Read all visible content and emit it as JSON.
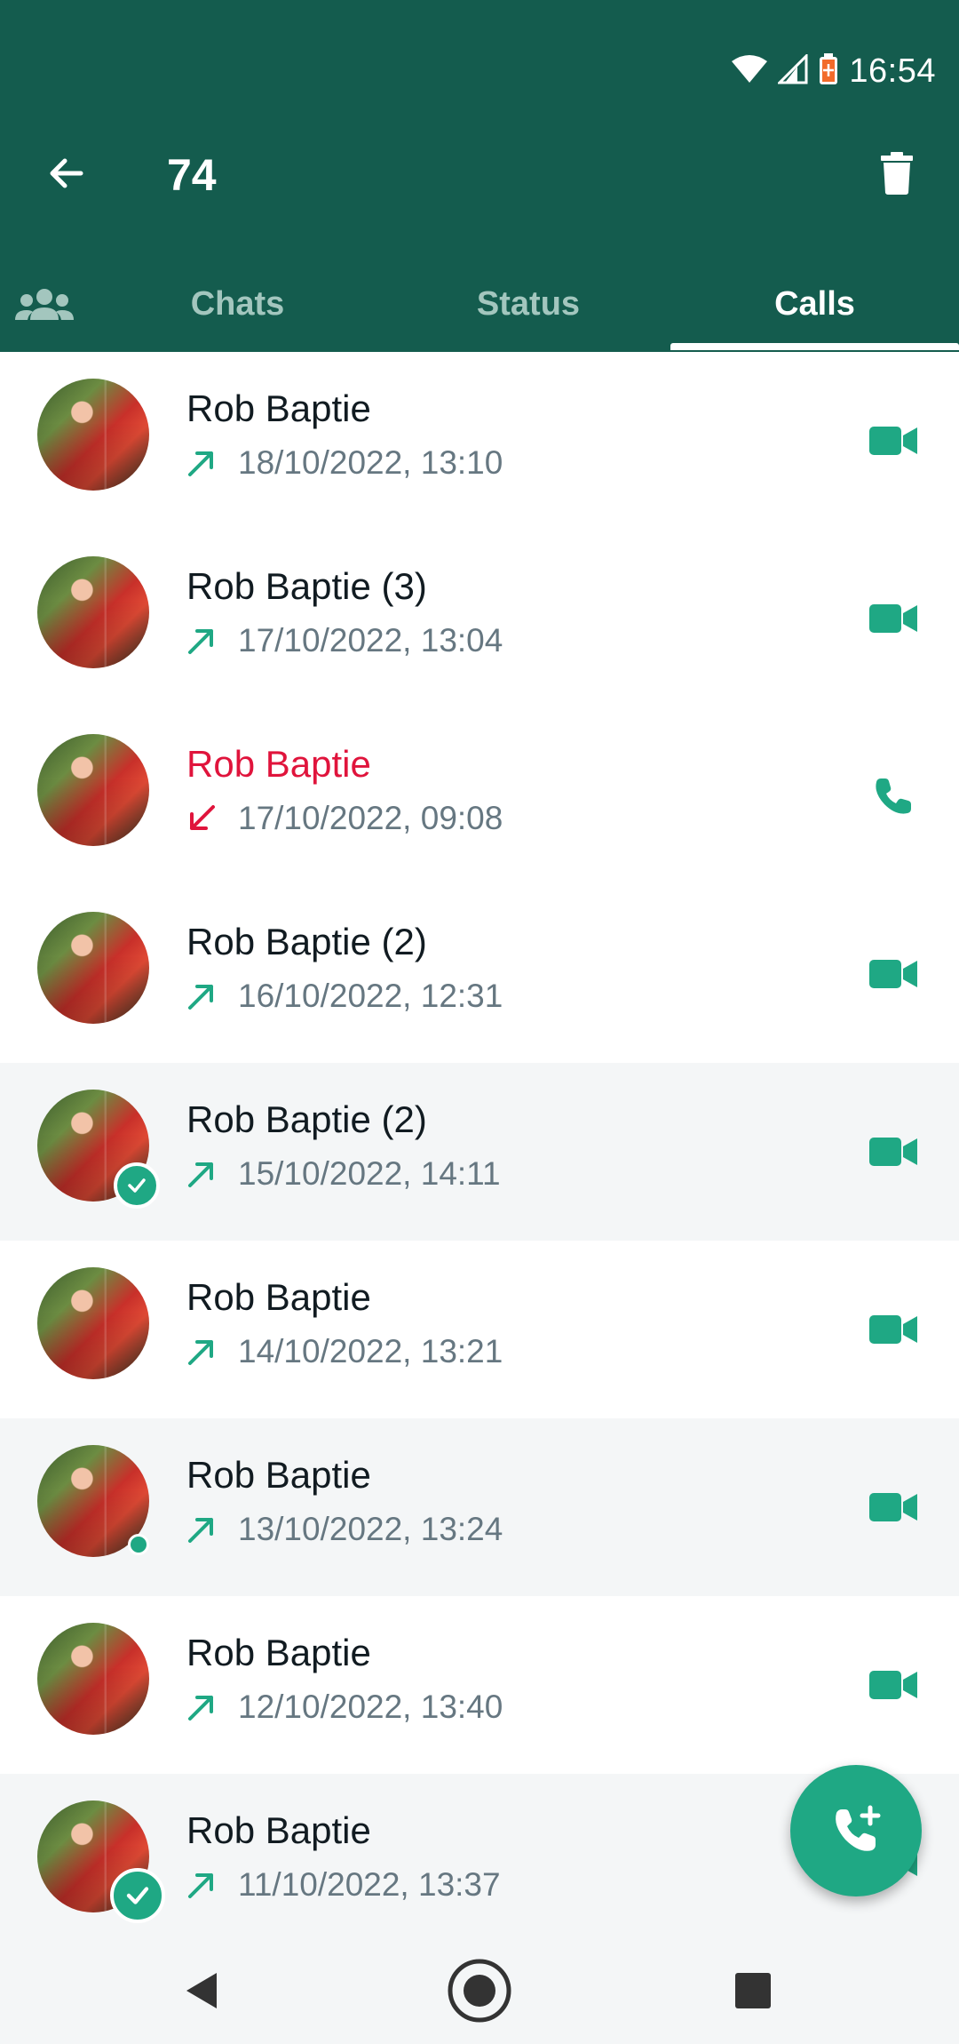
{
  "status_bar": {
    "time": "16:54",
    "icons": [
      "wifi-icon",
      "signal-icon",
      "battery-saver-icon"
    ]
  },
  "toolbar": {
    "back_icon": "arrow-back-icon",
    "title": "74",
    "delete_icon": "trash-icon"
  },
  "tabs": {
    "community_icon": "community-icon",
    "items": [
      {
        "label": "Chats",
        "active": false
      },
      {
        "label": "Status",
        "active": false
      },
      {
        "label": "Calls",
        "active": true
      }
    ]
  },
  "calls": [
    {
      "name": "Rob Baptie",
      "datetime": "18/10/2022, 13:10",
      "direction": "outgoing",
      "type": "video",
      "selected": false,
      "badge": "none"
    },
    {
      "name": "Rob Baptie (3)",
      "datetime": "17/10/2022, 13:04",
      "direction": "outgoing",
      "type": "video",
      "selected": false,
      "badge": "none"
    },
    {
      "name": "Rob Baptie",
      "datetime": "17/10/2022, 09:08",
      "direction": "missed",
      "type": "voice",
      "selected": false,
      "badge": "none"
    },
    {
      "name": "Rob Baptie (2)",
      "datetime": "16/10/2022, 12:31",
      "direction": "outgoing",
      "type": "video",
      "selected": false,
      "badge": "none"
    },
    {
      "name": "Rob Baptie (2)",
      "datetime": "15/10/2022, 14:11",
      "direction": "outgoing",
      "type": "video",
      "selected": true,
      "badge": "check"
    },
    {
      "name": "Rob Baptie",
      "datetime": "14/10/2022, 13:21",
      "direction": "outgoing",
      "type": "video",
      "selected": false,
      "badge": "none"
    },
    {
      "name": "Rob Baptie",
      "datetime": "13/10/2022, 13:24",
      "direction": "outgoing",
      "type": "video",
      "selected": true,
      "badge": "dot"
    },
    {
      "name": "Rob Baptie",
      "datetime": "12/10/2022, 13:40",
      "direction": "outgoing",
      "type": "video",
      "selected": false,
      "badge": "none"
    },
    {
      "name": "Rob Baptie",
      "datetime": "11/10/2022, 13:37",
      "direction": "outgoing",
      "type": "video",
      "selected": true,
      "badge": "check-big"
    }
  ],
  "fab": {
    "icon": "add-call-icon"
  },
  "nav": {
    "icons": [
      "nav-back-icon",
      "nav-home-icon",
      "nav-recents-icon"
    ]
  },
  "colors": {
    "header": "#145C4E",
    "accent": "#1FA884",
    "missed": "#E0143C",
    "outgoing_arrow": "#1FA884",
    "secondary_text": "#667781",
    "selected_row": "#F4F6F7"
  }
}
